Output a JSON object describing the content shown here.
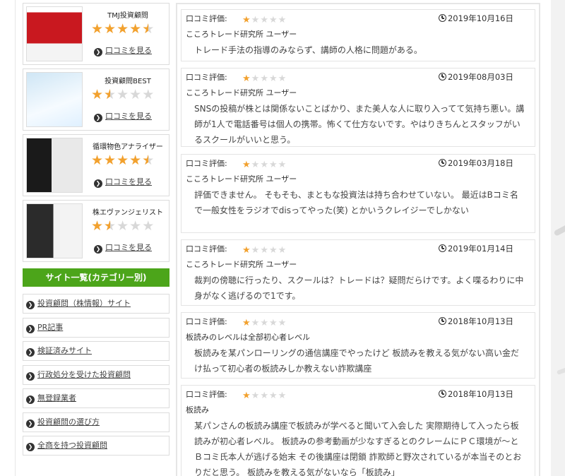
{
  "ranking": [
    {
      "name": "TMJ投資顧問",
      "rating": 4.5,
      "link": "口コミを見る"
    },
    {
      "name": "投資顧問BEST",
      "rating": 1.5,
      "link": "口コミを見る"
    },
    {
      "name": "循環物色アナライザー",
      "rating": 4.5,
      "link": "口コミを見る"
    },
    {
      "name": "株エヴァンジェリスト",
      "rating": 1.5,
      "link": "口コミを見る"
    }
  ],
  "categories": {
    "title": "サイト一覧(カテゴリー別)",
    "items": [
      "投資顧問（株情報）サイト",
      "PR記事",
      "検証済みサイト",
      "行政処分を受けた投資顧問",
      "無登録業者",
      "投資顧問の選び方",
      "全商を持つ投資顧問"
    ]
  },
  "reviews": [
    {
      "label": "口コミ評価:",
      "rating": 1,
      "date": "2019年10月16日",
      "user": "こころトレード研究所 ユーザー",
      "text": "トレード手法の指導のみならず、講師の人格に問題がある。"
    },
    {
      "label": "口コミ評価:",
      "rating": 1,
      "date": "2019年08月03日",
      "user": "こころトレード研究所 ユーザー",
      "text": "SNSの投稿が株とは関係ないことばかり、また美人な人に取り入ってて気持ち悪い。講師が1人で電話番号は個人の携帯。怖くて仕方ないです。やはりきちんとスタッフがいるスクールがいいと思う。"
    },
    {
      "label": "口コミ評価:",
      "rating": 1,
      "date": "2019年03月18日",
      "user": "こころトレード研究所 ユーザー",
      "text": "評価できません。 そもそも、まともな投資法は持ち合わせていない。 最近はBコミ名で一般女性をラジオでdisってやった(笑) とかいうクレイジーでしかない"
    },
    {
      "label": "口コミ評価:",
      "rating": 1,
      "date": "2019年01月14日",
      "user": "こころトレード研究所 ユーザー",
      "text": "裁判の傍聴に行ったり、スクールは？トレードは？疑問だらけです。よく喋るわりに中身がなく逃げるので1です。"
    },
    {
      "label": "口コミ評価:",
      "rating": 1,
      "date": "2018年10月13日",
      "user": "板読みのレベルは全部初心者レベル",
      "text": "板読みを某パンローリングの通信講座でやったけど 板読みを教える気がない高い金だけ払って初心者の板読みしか教えない詐欺講座"
    },
    {
      "label": "口コミ評価:",
      "rating": 1,
      "date": "2018年10月13日",
      "user": "板読み",
      "text": "某パンさんの板読み講座で板読みが学べると聞いて入会した 実際期待して入ったら板読みが初心者レベル。 板読みの参考動画が少なすぎるとのクレームにＰＣ環境が～とＢコミ氏本人が逃げる始末 その後講座は閉鎖 詐欺師と野次されているが本当そのとおりだと思う。 板読みを教える気がないなら「板読み」"
    }
  ]
}
